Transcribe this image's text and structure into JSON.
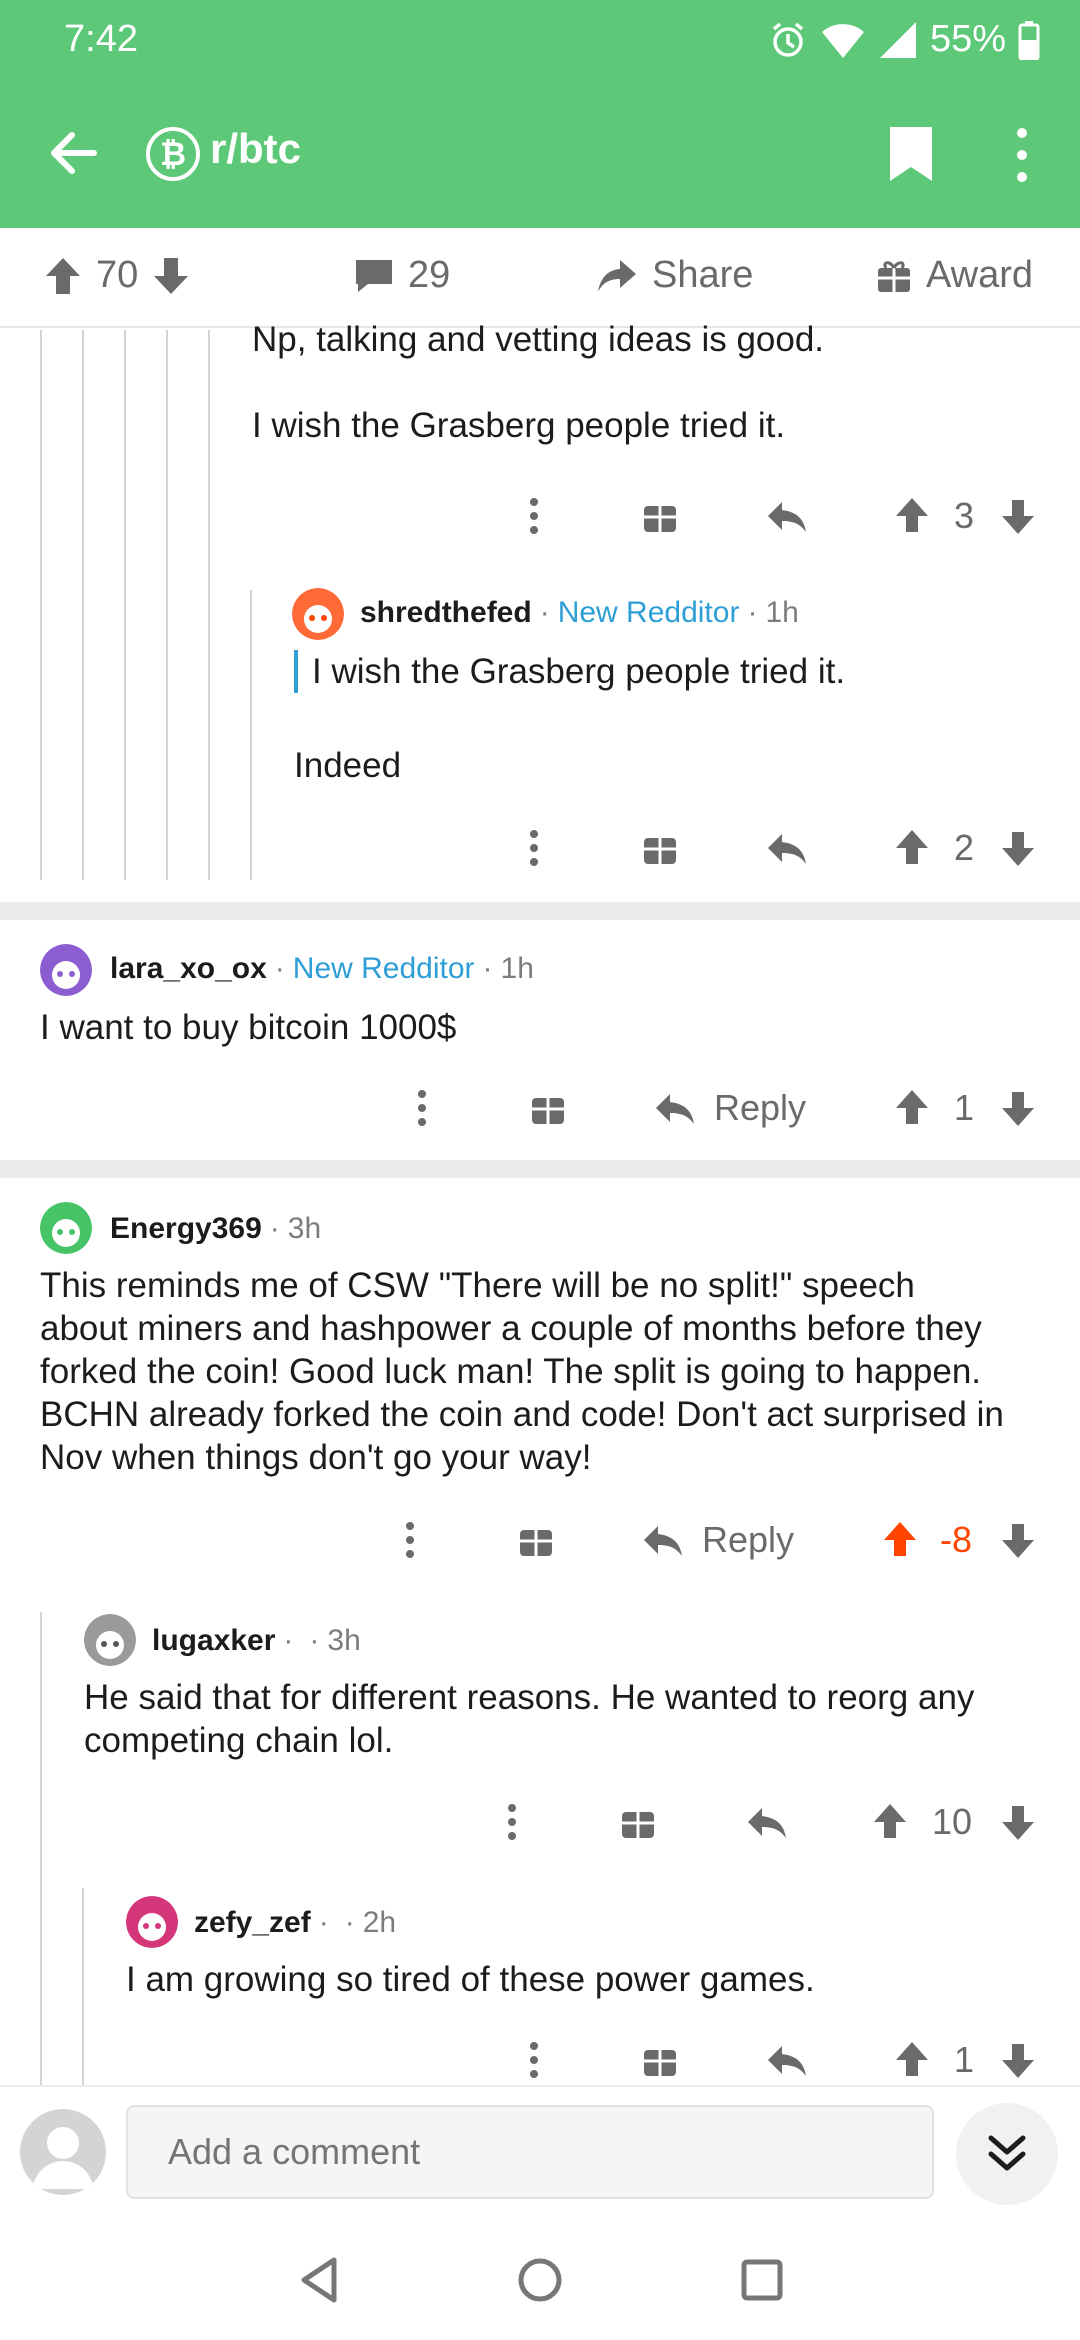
{
  "status": {
    "time": "7:42",
    "battery": "55%"
  },
  "appbar": {
    "subreddit": "r/btc"
  },
  "post_actions": {
    "votes": "70",
    "comments": "29",
    "share": "Share",
    "award": "Award"
  },
  "comments": [
    {
      "text_lines": [
        "Np, talking and vetting ideas is good.",
        "",
        "I wish the Grasberg people tried it."
      ],
      "score": "3"
    },
    {
      "user": "shredthefed",
      "flair": "New Redditor",
      "age": "1h",
      "quote": "I wish the Grasberg people tried it.",
      "text": "Indeed",
      "score": "2"
    },
    {
      "user": "lara_xo_ox",
      "flair": "New Redditor",
      "age": "1h",
      "text": "I want to buy bitcoin 1000$",
      "reply": "Reply",
      "score": "1"
    },
    {
      "user": "Energy369",
      "age": "3h",
      "text_lines": [
        "This reminds me of CSW \"There will be no split!\" speech",
        "about miners and  hashpower a couple of months before they",
        "forked the coin! Good luck  man! The split is going to happen.",
        "BCHN already forked the coin and  code! Don't act surprised in",
        "Nov when things don't go your way!"
      ],
      "reply": "Reply",
      "score": "-8",
      "score_color": "#ff4500"
    },
    {
      "user": "lugaxker",
      "age": "3h",
      "text_lines": [
        "He said that for different reasons. He wanted to reorg any",
        "competing chain lol."
      ],
      "score": "10"
    },
    {
      "user": "zefy_zef",
      "age": "2h",
      "text": "I am growing so tired of these power games.",
      "score": "1"
    }
  ],
  "composer": {
    "placeholder": "Add a comment"
  },
  "colors": {
    "header": "#5dc978",
    "flair": "#2e9fd6",
    "upvoted": "#ff4500"
  }
}
